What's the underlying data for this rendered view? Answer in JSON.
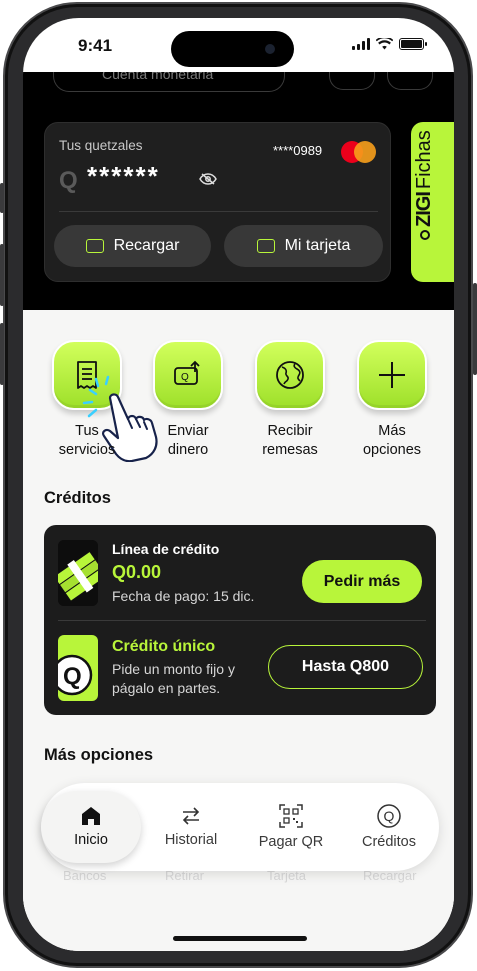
{
  "status_bar": {
    "time": "9:41"
  },
  "account": {
    "label": "Cuenta monetaria"
  },
  "card": {
    "title": "Tus quetzales",
    "currency": "Q",
    "masked_balance": "******",
    "card_number": "****0989"
  },
  "card_actions": [
    {
      "label": "Recargar",
      "icon": "recharge-icon"
    },
    {
      "label": "Mi tarjeta",
      "icon": "card-icon"
    }
  ],
  "promo": {
    "brand": "ZIGI",
    "label": "Fichas"
  },
  "quick_actions": [
    {
      "label_1": "Tus",
      "label_2": "servicios",
      "icon": "receipt-icon"
    },
    {
      "label_1": "Enviar",
      "label_2": "dinero",
      "icon": "send-money-icon"
    },
    {
      "label_1": "Recibir",
      "label_2": "remesas",
      "icon": "globe-icon"
    },
    {
      "label_1": "Más",
      "label_2": "opciones",
      "icon": "plus-icon"
    }
  ],
  "credits": {
    "section_title": "Créditos",
    "line": {
      "title": "Línea de crédito",
      "amount": "Q0.00",
      "subtitle": "Fecha de pago: 15 dic.",
      "button": "Pedir más"
    },
    "single": {
      "title": "Crédito único",
      "line1": "Pide un monto fijo y",
      "line2": "págalo en partes.",
      "button": "Hasta Q800"
    }
  },
  "more_options": {
    "section_title": "Más opciones",
    "items": [
      "Bancos",
      "Retirar",
      "Tarjeta",
      "Recargar"
    ]
  },
  "nav": [
    {
      "label": "Inicio",
      "icon": "home-icon",
      "active": true
    },
    {
      "label": "Historial",
      "icon": "swap-arrows-icon",
      "active": false
    },
    {
      "label": "Pagar QR",
      "icon": "qr-code-icon",
      "active": false
    },
    {
      "label": "Créditos",
      "icon": "credit-q-icon",
      "active": false
    }
  ],
  "colors": {
    "accent": "#b8f53a",
    "dark": "#000000",
    "card": "#1f1f1f"
  }
}
